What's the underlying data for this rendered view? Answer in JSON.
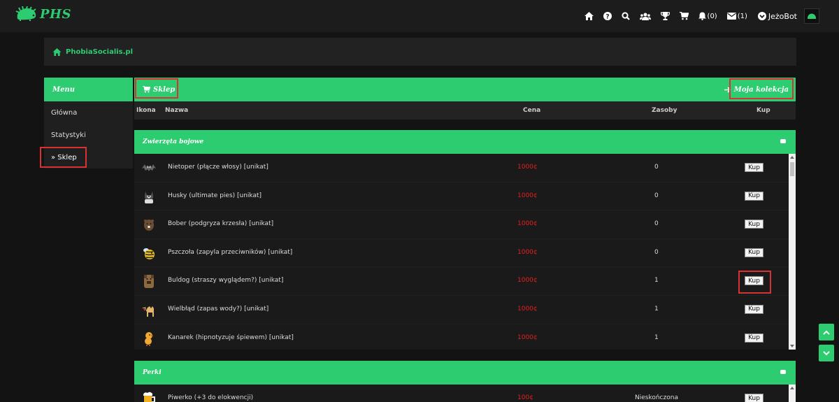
{
  "brand": {
    "name": "PHS",
    "accent": "#2ecc71",
    "danger": "#e52020"
  },
  "nav": {
    "icons": [
      "home-icon",
      "help-icon",
      "search-icon",
      "users-icon",
      "trophy-icon",
      "cart-icon"
    ],
    "notifications": "(0)",
    "messages": "(1)",
    "username": "JeżoBot"
  },
  "breadcrumb": {
    "label": "PhobiaSocialis.pl"
  },
  "sidebar": {
    "title": "Menu",
    "items": [
      {
        "label": "Główna"
      },
      {
        "label": "Statystyki"
      },
      {
        "label": "» Sklep"
      }
    ]
  },
  "shop": {
    "title": "Sklep",
    "collection_link": "Moja kolekcja",
    "columns": {
      "icon": "Ikona",
      "name": "Nazwa",
      "price": "Cena",
      "stock": "Zasoby",
      "buy": "Kup"
    }
  },
  "categories": [
    {
      "title": "Zwierzęta bojowe",
      "items": [
        {
          "icon": "bat-icon",
          "name": "Nietoper (płącze włosy) [unikat]",
          "price": "1000¢",
          "stock": "0",
          "buy": "Kup"
        },
        {
          "icon": "husky-icon",
          "name": "Husky (ultimate pies) [unikat]",
          "price": "1000¢",
          "stock": "0",
          "buy": "Kup"
        },
        {
          "icon": "beaver-icon",
          "name": "Bober (podgryza krzesła) [unikat]",
          "price": "1000¢",
          "stock": "0",
          "buy": "Kup"
        },
        {
          "icon": "bee-icon",
          "name": "Pszczoła (zapyla przeciwników) [unikat]",
          "price": "1000¢",
          "stock": "0",
          "buy": "Kup"
        },
        {
          "icon": "bulldog-icon",
          "name": "Buldog (straszy wyglądem?) [unikat]",
          "price": "1000¢",
          "stock": "1",
          "buy": "Kup"
        },
        {
          "icon": "camel-icon",
          "name": "Wielbłąd (zapas wody?) [unikat]",
          "price": "1000¢",
          "stock": "1",
          "buy": "Kup"
        },
        {
          "icon": "canary-icon",
          "name": "Kanarek (hipnotyzuje śpiewem) [unikat]",
          "price": "1000¢",
          "stock": "1",
          "buy": "Kup"
        }
      ]
    },
    {
      "title": "Perki",
      "items": [
        {
          "icon": "beer-icon",
          "name": "Piwerko (+3 do elokwencji)",
          "price": "100¢",
          "stock": "Nieskończona",
          "buy": "Kup"
        }
      ]
    }
  ]
}
